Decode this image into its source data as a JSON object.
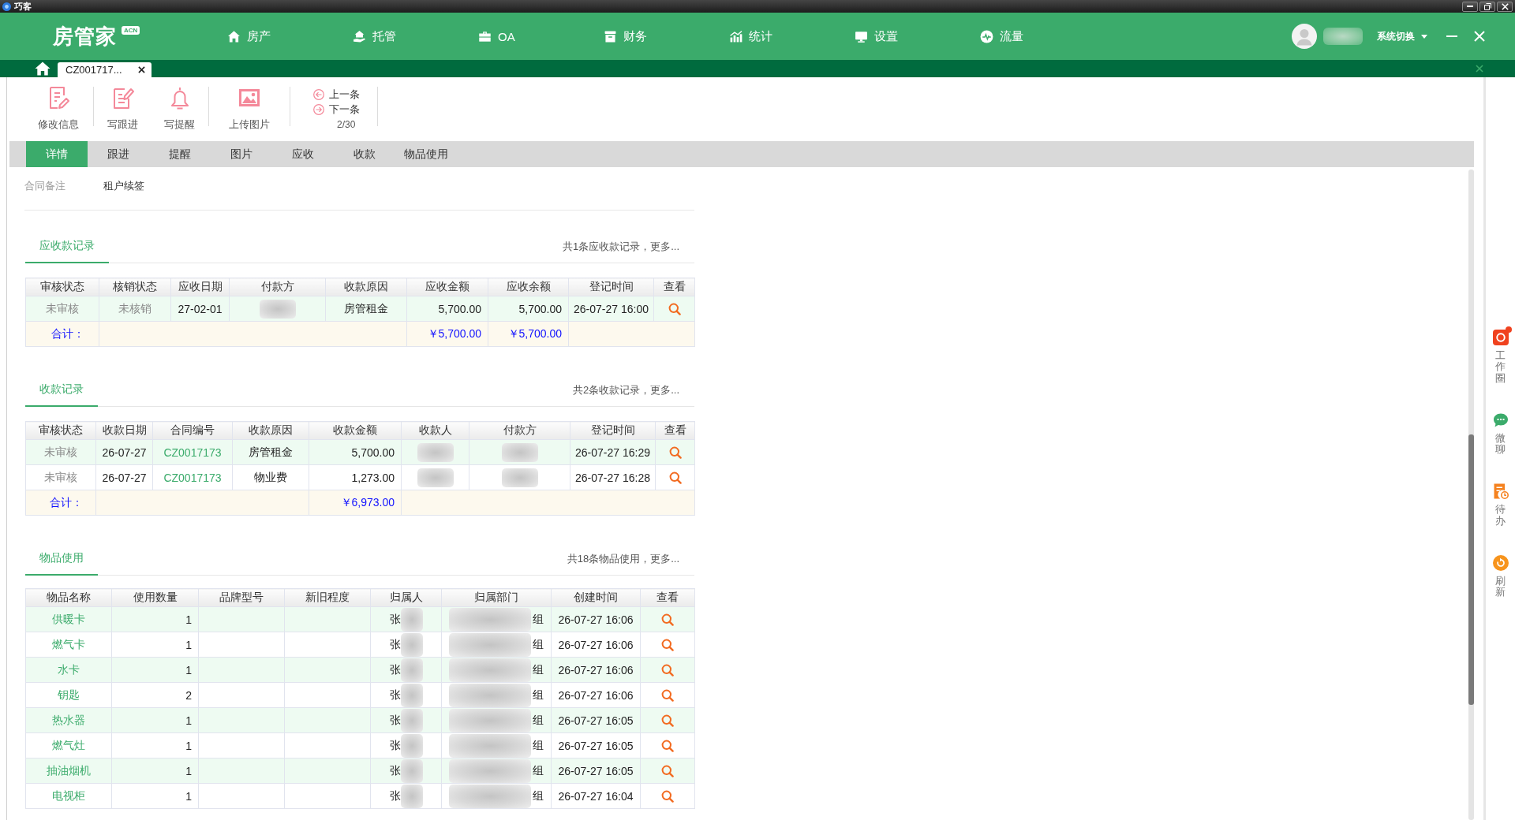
{
  "window": {
    "title": "巧客"
  },
  "header": {
    "logo": "房管家",
    "logo_badge": "ACN",
    "nav": [
      {
        "label": "房产"
      },
      {
        "label": "托管"
      },
      {
        "label": "OA"
      },
      {
        "label": "财务"
      },
      {
        "label": "统计"
      },
      {
        "label": "设置"
      },
      {
        "label": "流量"
      }
    ],
    "user": {
      "name_blurred": true
    },
    "switch_label": "系统切换"
  },
  "tab_strip": {
    "tabs": [
      {
        "label": "CZ001717...",
        "selected": true
      }
    ]
  },
  "toolbar": {
    "actions": [
      {
        "label": "修改信息"
      },
      {
        "label": "写跟进"
      },
      {
        "label": "写提醒"
      },
      {
        "label": "上传图片"
      }
    ],
    "pager": {
      "prev": "上一条",
      "next": "下一条",
      "position": "2/30"
    }
  },
  "detail_tabs": [
    {
      "label": "详情",
      "selected": true
    },
    {
      "label": "跟进",
      "selected": false
    },
    {
      "label": "提醒",
      "selected": false
    },
    {
      "label": "图片",
      "selected": false
    },
    {
      "label": "应收",
      "selected": false
    },
    {
      "label": "收款",
      "selected": false
    },
    {
      "label": "物品使用",
      "selected": false
    }
  ],
  "contract_note": {
    "label": "合同备注",
    "value": "租户续签"
  },
  "sections": [
    {
      "title": "应收款记录",
      "summary": "共1条应收款记录，更多...",
      "table": {
        "columns": [
          {
            "label": "审核状态",
            "kind": "status"
          },
          {
            "label": "核销状态",
            "kind": "status"
          },
          {
            "label": "应收日期",
            "kind": "text"
          },
          {
            "label": "付款方",
            "kind": "text"
          },
          {
            "label": "收款原因",
            "kind": "text"
          },
          {
            "label": "应收金额",
            "kind": "number",
            "total": "￥5,700.00"
          },
          {
            "label": "应收余额",
            "kind": "number",
            "total": "￥5,700.00"
          },
          {
            "label": "登记时间",
            "kind": "text"
          },
          {
            "label": "查看",
            "kind": "view"
          }
        ],
        "rows": [
          [
            "未审核",
            "未核销",
            "27-02-01",
            {
              "blurred": true
            },
            "房管租金",
            "5,700.00",
            "5,700.00",
            "26-07-27 16:00"
          ]
        ],
        "total_label": "合计："
      }
    },
    {
      "title": "收款记录",
      "summary": "共2条收款记录，更多...",
      "table": {
        "columns": [
          {
            "label": "审核状态",
            "kind": "status"
          },
          {
            "label": "收款日期",
            "kind": "text"
          },
          {
            "label": "合同编号",
            "kind": "link"
          },
          {
            "label": "收款原因",
            "kind": "text"
          },
          {
            "label": "收款金额",
            "kind": "number",
            "total": "￥6,973.00"
          },
          {
            "label": "收款人",
            "kind": "text"
          },
          {
            "label": "付款方",
            "kind": "text"
          },
          {
            "label": "登记时间",
            "kind": "text"
          },
          {
            "label": "查看",
            "kind": "view"
          }
        ],
        "rows": [
          [
            "未审核",
            "26-07-27",
            "CZ0017173",
            "房管租金",
            "5,700.00",
            {
              "blurred": true
            },
            {
              "blurred": true
            },
            "26-07-27 16:29"
          ],
          [
            "未审核",
            "26-07-27",
            "CZ0017173",
            "物业费",
            "1,273.00",
            {
              "blurred": true
            },
            {
              "blurred": true
            },
            "26-07-27 16:28"
          ]
        ],
        "total_label": "合计："
      }
    },
    {
      "title": "物品使用",
      "summary": "共18条物品使用，更多...",
      "table": {
        "columns": [
          {
            "label": "物品名称",
            "kind": "link"
          },
          {
            "label": "使用数量",
            "kind": "number"
          },
          {
            "label": "品牌型号",
            "kind": "text"
          },
          {
            "label": "新旧程度",
            "kind": "text"
          },
          {
            "label": "归属人",
            "kind": "text"
          },
          {
            "label": "归属部门",
            "kind": "text"
          },
          {
            "label": "创建时间",
            "kind": "text"
          },
          {
            "label": "查看",
            "kind": "view"
          }
        ],
        "rows": [
          [
            "供暖卡",
            "1",
            null,
            null,
            {
              "before": "张",
              "blurred": true
            },
            {
              "blurred": true,
              "after": "组"
            },
            "26-07-27 16:06"
          ],
          [
            "燃气卡",
            "1",
            null,
            null,
            {
              "before": "张",
              "blurred": true
            },
            {
              "blurred": true,
              "after": "组"
            },
            "26-07-27 16:06"
          ],
          [
            "水卡",
            "1",
            null,
            null,
            {
              "before": "张",
              "blurred": true
            },
            {
              "blurred": true,
              "after": "组"
            },
            "26-07-27 16:06"
          ],
          [
            "钥匙",
            "2",
            null,
            null,
            {
              "before": "张",
              "blurred": true
            },
            {
              "blurred": true,
              "after": "组"
            },
            "26-07-27 16:06"
          ],
          [
            "热水器",
            "1",
            null,
            null,
            {
              "before": "张",
              "blurred": true
            },
            {
              "blurred": true,
              "after": "组"
            },
            "26-07-27 16:05"
          ],
          [
            "燃气灶",
            "1",
            null,
            null,
            {
              "before": "张",
              "blurred": true
            },
            {
              "blurred": true,
              "after": "组"
            },
            "26-07-27 16:05"
          ],
          [
            "抽油烟机",
            "1",
            null,
            null,
            {
              "before": "张",
              "blurred": true
            },
            {
              "blurred": true,
              "after": "组"
            },
            "26-07-27 16:05"
          ],
          [
            "电视柜",
            "1",
            null,
            null,
            {
              "before": "张",
              "blurred": true
            },
            {
              "blurred": true,
              "after": "组"
            },
            "26-07-27 16:04"
          ]
        ]
      }
    }
  ],
  "side_panel": {
    "items": [
      {
        "label": "工作圈",
        "notification": true
      },
      {
        "label": "微聊",
        "notification": false
      },
      {
        "label": "待办",
        "notification": false
      },
      {
        "label": "刷新",
        "notification": false
      }
    ]
  }
}
